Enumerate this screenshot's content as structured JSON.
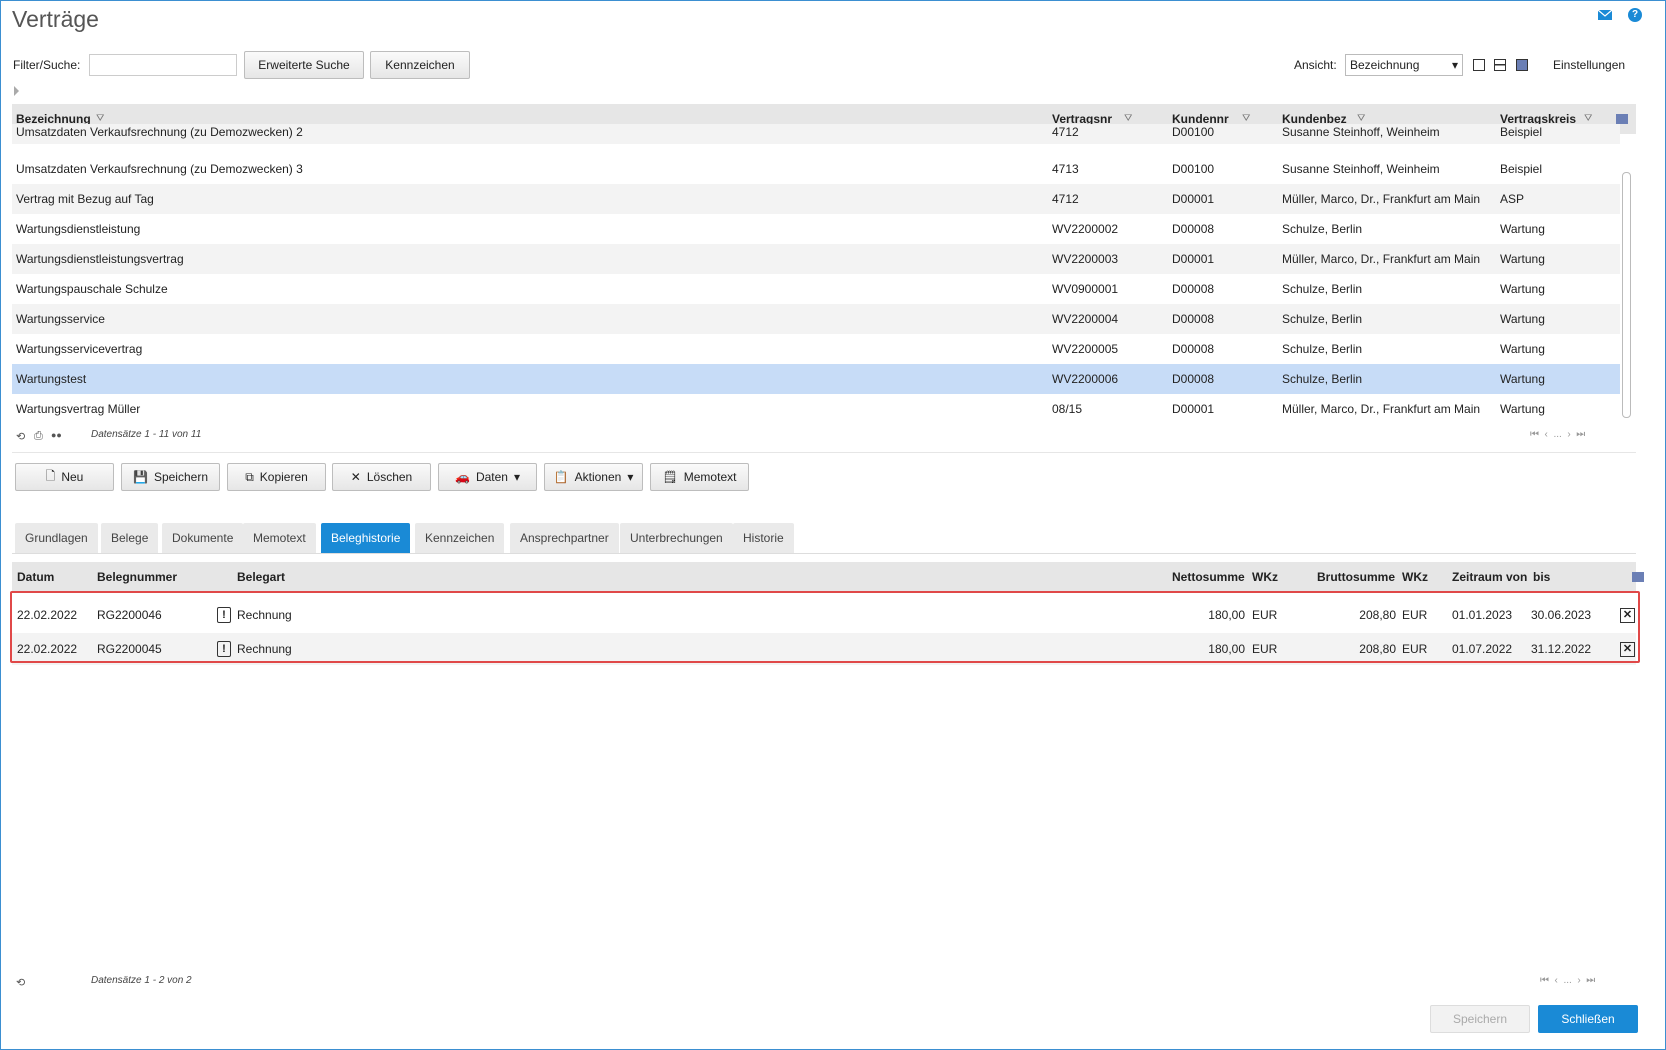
{
  "window": {
    "title": "Verträge"
  },
  "toolbar": {
    "filter_label": "Filter/Suche:",
    "filter_value": "",
    "advanced_search": "Erweiterte Suche",
    "tags": "Kennzeichen",
    "view_label": "Ansicht:",
    "view_value": "Bezeichnung",
    "settings": "Einstellungen"
  },
  "contracts": {
    "columns": [
      "Bezeichnung",
      "Vertragsnr",
      "Kundennr",
      "Kundenbez",
      "Vertragskreis"
    ],
    "rows": [
      [
        "Umsatzdaten Verkaufsrechnung (zu Demozwecken) 2",
        "4712",
        "D00100",
        "Susanne Steinhoff, Weinheim",
        "Beispiel"
      ],
      [
        "Umsatzdaten Verkaufsrechnung (zu Demozwecken) 3",
        "4713",
        "D00100",
        "Susanne Steinhoff, Weinheim",
        "Beispiel"
      ],
      [
        "Vertrag mit Bezug auf Tag",
        "4712",
        "D00001",
        "Müller, Marco, Dr., Frankfurt am Main",
        "ASP"
      ],
      [
        "Wartungsdienstleistung",
        "WV2200002",
        "D00008",
        "Schulze, Berlin",
        "Wartung"
      ],
      [
        "Wartungsdienstleistungsvertrag",
        "WV2200003",
        "D00001",
        "Müller, Marco, Dr., Frankfurt am Main",
        "Wartung"
      ],
      [
        "Wartungspauschale Schulze",
        "WV0900001",
        "D00008",
        "Schulze, Berlin",
        "Wartung"
      ],
      [
        "Wartungsservice",
        "WV2200004",
        "D00008",
        "Schulze, Berlin",
        "Wartung"
      ],
      [
        "Wartungsservicevertrag",
        "WV2200005",
        "D00008",
        "Schulze, Berlin",
        "Wartung"
      ],
      [
        "Wartungstest",
        "WV2200006",
        "D00008",
        "Schulze, Berlin",
        "Wartung"
      ],
      [
        "Wartungsvertrag Müller",
        "08/15",
        "D00001",
        "Müller, Marco, Dr., Frankfurt am Main",
        "Wartung"
      ]
    ],
    "selected_row": 8,
    "records": "Datensätze 1 - 11 von 11"
  },
  "actions": {
    "new": "Neu",
    "save": "Speichern",
    "copy": "Kopieren",
    "delete": "Löschen",
    "data": "Daten",
    "actions": "Aktionen",
    "memo": "Memotext"
  },
  "tabs": [
    "Grundlagen",
    "Belege",
    "Dokumente",
    "Memotext",
    "Beleghistorie",
    "Kennzeichen",
    "Ansprechpartner",
    "Unterbrechungen",
    "Historie"
  ],
  "active_tab": 4,
  "history": {
    "columns": {
      "date": "Datum",
      "number": "Belegnummer",
      "type": "Belegart",
      "net": "Nettosumme",
      "wkz1": "WKz",
      "gross": "Bruttosumme",
      "wkz2": "WKz",
      "period": "Zeitraum von",
      "to": "bis"
    },
    "rows": [
      {
        "date": "22.02.2022",
        "number": "RG2200046",
        "type": "Rechnung",
        "net": "180,00",
        "wkz1": "EUR",
        "gross": "208,80",
        "wkz2": "EUR",
        "from": "01.01.2023",
        "to": "30.06.2023"
      },
      {
        "date": "22.02.2022",
        "number": "RG2200045",
        "type": "Rechnung",
        "net": "180,00",
        "wkz1": "EUR",
        "gross": "208,80",
        "wkz2": "EUR",
        "from": "01.07.2022",
        "to": "31.12.2022"
      }
    ],
    "records": "Datensätze 1 - 2 von 2"
  },
  "footer": {
    "save": "Speichern",
    "close": "Schließen"
  },
  "colors": {
    "accent": "#1a8ad6",
    "selected_row": "#c7dcf7",
    "highlight": "#e04848"
  }
}
